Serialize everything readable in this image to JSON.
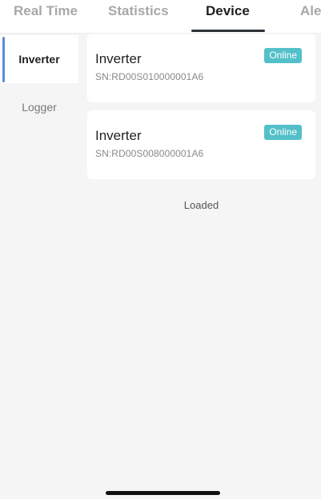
{
  "tabs": [
    {
      "label": "Real Time",
      "active": false
    },
    {
      "label": "Statistics",
      "active": false
    },
    {
      "label": "Device",
      "active": true
    },
    {
      "label": "Ale",
      "active": false
    }
  ],
  "sidebar": {
    "items": [
      {
        "label": "Inverter",
        "active": true
      },
      {
        "label": "Logger",
        "active": false
      }
    ]
  },
  "devices": [
    {
      "name": "Inverter",
      "sn": "SN:RD00S010000001A6",
      "status": "Online"
    },
    {
      "name": "Inverter",
      "sn": "SN:RD00S008000001A6",
      "status": "Online"
    }
  ],
  "list_footer": "Loaded",
  "colors": {
    "status_online": "#53c0c9",
    "sidebar_accent": "#5a8be0",
    "tab_indicator": "#2b2f36"
  }
}
